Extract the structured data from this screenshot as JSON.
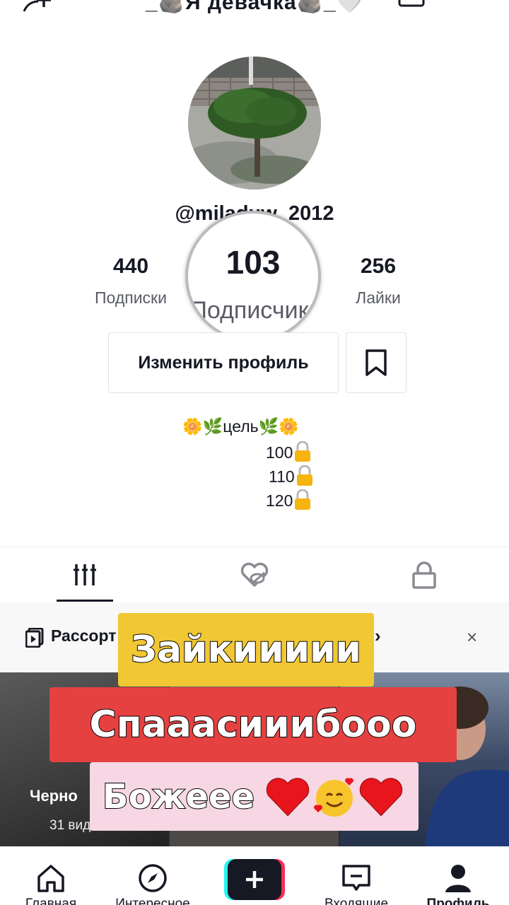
{
  "header": {
    "title": "_🪨Я девачка🪨_🤍",
    "add_user_icon": "add-user-icon",
    "qr_icon": "qr-code-icon",
    "menu_icon": "hamburger-menu-icon"
  },
  "profile": {
    "username": "@miladuw_2012",
    "avatar": "tree-photo-avatar"
  },
  "stats": {
    "following": {
      "value": "440",
      "label": "Подписки"
    },
    "followers": {
      "value": "103",
      "label": "Подписчики"
    },
    "likes": {
      "value": "256",
      "label": "Лайки"
    }
  },
  "actions": {
    "edit_profile": "Изменить профиль",
    "bookmark_icon": "bookmark-icon"
  },
  "bio": {
    "line1": "🌼🌿цель🌿🌼",
    "goals": [
      "100",
      "110",
      "120"
    ],
    "goal_icon": "lock-icon"
  },
  "tabs": [
    {
      "name": "videos",
      "icon": "grid-icon",
      "active": true
    },
    {
      "name": "liked",
      "icon": "heart-hidden-icon",
      "active": false
    },
    {
      "name": "private",
      "icon": "lock-icon",
      "active": false
    }
  ],
  "playlist_bar": {
    "text": "Рассорт",
    "arrow": "›",
    "close": "×"
  },
  "grid": {
    "cell1_title": "Черно",
    "cell1_sub": "31 вид"
  },
  "captions": {
    "line1": "Зайкиииии",
    "line2": "Спааасииибооо",
    "line3": "Божеее"
  },
  "bottom_nav": [
    {
      "label": "Главная",
      "icon": "home-icon"
    },
    {
      "label": "Интересное",
      "icon": "compass-icon"
    },
    {
      "label": "",
      "icon": "create-plus-icon"
    },
    {
      "label": "Входящие",
      "icon": "inbox-icon"
    },
    {
      "label": "Профиль",
      "icon": "profile-icon"
    }
  ],
  "colors": {
    "caption1_bg": "#f1c733",
    "caption2_bg": "#e54141",
    "caption3_bg": "#f7d7e3",
    "text_primary": "#161823",
    "create_cyan": "#25f4ee",
    "create_pink": "#fe2c55"
  }
}
